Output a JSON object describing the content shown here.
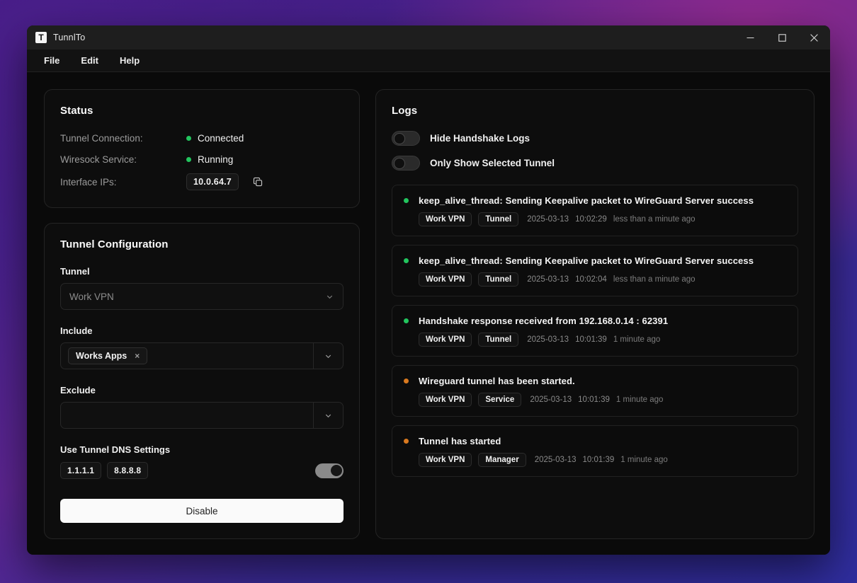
{
  "window": {
    "app_logo_letter": "T",
    "title": "TunnlTo",
    "controls": {
      "minimize": "minimize-icon",
      "maximize": "maximize-icon",
      "close": "close-icon"
    }
  },
  "menubar": {
    "items": [
      {
        "label": "File"
      },
      {
        "label": "Edit"
      },
      {
        "label": "Help"
      }
    ]
  },
  "status": {
    "title": "Status",
    "rows": [
      {
        "label": "Tunnel Connection:",
        "value": "Connected",
        "dot": "green"
      },
      {
        "label": "Wiresock Service:",
        "value": "Running",
        "dot": "green"
      }
    ],
    "interface_ips": {
      "label": "Interface IPs:",
      "value": "10.0.64.7",
      "copy_icon": "copy-icon"
    }
  },
  "tunnel_config": {
    "title": "Tunnel Configuration",
    "tunnel": {
      "label": "Tunnel",
      "value": "Work VPN",
      "chevron": "chevron-down-icon"
    },
    "include": {
      "label": "Include",
      "chips": [
        {
          "label": "Works Apps",
          "remove": "×"
        }
      ],
      "chevron": "chevron-down-icon"
    },
    "exclude": {
      "label": "Exclude",
      "chips": [],
      "chevron": "chevron-down-icon"
    },
    "dns": {
      "label": "Use Tunnel DNS Settings",
      "servers": [
        "1.1.1.1",
        "8.8.8.8"
      ],
      "enabled": true
    },
    "action_button": "Disable"
  },
  "logs": {
    "title": "Logs",
    "toggles": [
      {
        "label": "Hide Handshake Logs",
        "enabled": false
      },
      {
        "label": "Only Show Selected Tunnel",
        "enabled": false
      }
    ],
    "entries": [
      {
        "dot": "green",
        "message": "keep_alive_thread: Sending Keepalive packet to WireGuard Server success",
        "tunnel_tag": "Work VPN",
        "source_tag": "Tunnel",
        "date": "2025-03-13",
        "time": "10:02:29",
        "relative": "less than a minute ago"
      },
      {
        "dot": "green",
        "message": "keep_alive_thread: Sending Keepalive packet to WireGuard Server success",
        "tunnel_tag": "Work VPN",
        "source_tag": "Tunnel",
        "date": "2025-03-13",
        "time": "10:02:04",
        "relative": "less than a minute ago"
      },
      {
        "dot": "green",
        "message": "Handshake response received from 192.168.0.14 : 62391",
        "tunnel_tag": "Work VPN",
        "source_tag": "Tunnel",
        "date": "2025-03-13",
        "time": "10:01:39",
        "relative": "1 minute ago"
      },
      {
        "dot": "orange",
        "message": "Wireguard tunnel has been started.",
        "tunnel_tag": "Work VPN",
        "source_tag": "Service",
        "date": "2025-03-13",
        "time": "10:01:39",
        "relative": "1 minute ago"
      },
      {
        "dot": "orange",
        "message": "Tunnel has started",
        "tunnel_tag": "Work VPN",
        "source_tag": "Manager",
        "date": "2025-03-13",
        "time": "10:01:39",
        "relative": "1 minute ago"
      }
    ]
  },
  "colors": {
    "status_green": "#22c55e",
    "status_orange": "#d9791f",
    "accent_button": "#fafafa",
    "panel_bg": "#0d0d0d",
    "window_bg": "#0a0a0a"
  }
}
